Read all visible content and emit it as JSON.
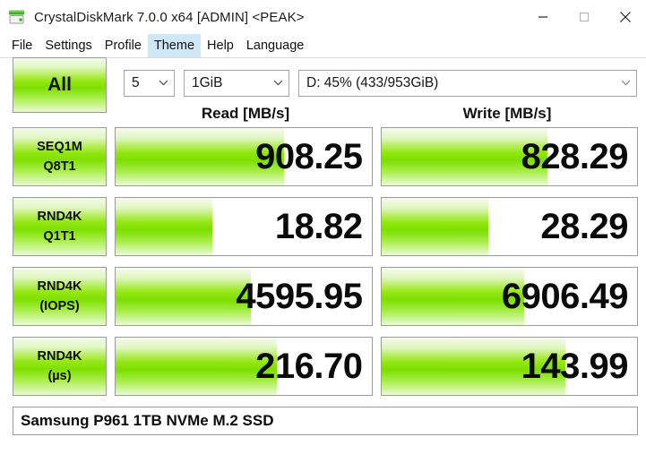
{
  "window": {
    "title": "CrystalDiskMark 7.0.0 x64 [ADMIN] <PEAK>",
    "icon": "disk-drive-icon",
    "controls": {
      "minimize": "minimize-icon",
      "maximize": "maximize-icon",
      "close": "close-icon"
    }
  },
  "menu": {
    "items": [
      {
        "label": "File",
        "active": false
      },
      {
        "label": "Settings",
        "active": false
      },
      {
        "label": "Profile",
        "active": false
      },
      {
        "label": "Theme",
        "active": true
      },
      {
        "label": "Help",
        "active": false
      },
      {
        "label": "Language",
        "active": false
      }
    ]
  },
  "toolbar": {
    "all_button_label": "All",
    "run_count": "5",
    "test_size": "1GiB",
    "target_drive": "D: 45% (433/953GiB)",
    "chevron": "chevron-down-icon"
  },
  "columns": {
    "read_header": "Read [MB/s]",
    "write_header": "Write [MB/s]"
  },
  "chart_data": {
    "type": "bar",
    "title": "CrystalDiskMark 7.0.0 benchmark results",
    "xlabel": "",
    "ylabel": "",
    "categories": [
      "SEQ1M Q8T1",
      "RND4K Q1T1",
      "RND4K (IOPS)",
      "RND4K (µs)"
    ],
    "series": [
      {
        "name": "Read [MB/s]",
        "values": [
          908.25,
          18.82,
          4595.95,
          216.7
        ]
      },
      {
        "name": "Write [MB/s]",
        "values": [
          828.29,
          28.29,
          6906.49,
          143.99
        ]
      }
    ],
    "bar_fill_percent": {
      "read": [
        66,
        38,
        53,
        63
      ],
      "write": [
        65,
        42,
        56,
        72
      ]
    },
    "legend": [
      "Read [MB/s]",
      "Write [MB/s]"
    ],
    "grid": false
  },
  "rows": [
    {
      "label_line1": "SEQ1M",
      "label_line2": "Q8T1",
      "read_value": "908.25",
      "write_value": "828.29",
      "read_fill": 66,
      "write_fill": 65
    },
    {
      "label_line1": "RND4K",
      "label_line2": "Q1T1",
      "read_value": "18.82",
      "write_value": "28.29",
      "read_fill": 38,
      "write_fill": 42
    },
    {
      "label_line1": "RND4K",
      "label_line2": "(IOPS)",
      "read_value": "4595.95",
      "write_value": "6906.49",
      "read_fill": 53,
      "write_fill": 56
    },
    {
      "label_line1": "RND4K",
      "label_line2": "(µs)",
      "read_value": "216.70",
      "write_value": "143.99",
      "read_fill": 63,
      "write_fill": 72
    }
  ],
  "comment": {
    "text": "Samsung P961 1TB NVMe M.2 SSD"
  },
  "colors": {
    "accent_green": "#7ee000",
    "menu_highlight": "#cfe8f7",
    "border": "#9a9a9a"
  }
}
